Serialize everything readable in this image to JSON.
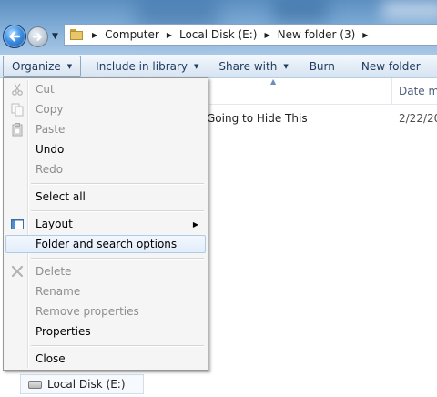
{
  "address_bar": {
    "breadcrumbs": [
      "Computer",
      "Local Disk (E:)",
      "New folder (3)"
    ]
  },
  "command_bar": {
    "organize": "Organize",
    "include_in_library": "Include in library",
    "share_with": "Share with",
    "burn": "Burn",
    "new_folder": "New folder"
  },
  "file_list": {
    "column_date": "Date m",
    "items": [
      {
        "name": "Going to Hide This",
        "date": "2/22/20"
      }
    ]
  },
  "navigation_pane": {
    "drive_label": "Local Disk (E:)"
  },
  "organize_menu": {
    "items": [
      {
        "label": "Cut",
        "enabled": false,
        "icon": "cut-icon"
      },
      {
        "label": "Copy",
        "enabled": false,
        "icon": "copy-icon"
      },
      {
        "label": "Paste",
        "enabled": false,
        "icon": "paste-icon"
      },
      {
        "label": "Undo",
        "enabled": true
      },
      {
        "label": "Redo",
        "enabled": false
      },
      {
        "label": "Select all",
        "enabled": true
      },
      {
        "label": "Layout",
        "enabled": true,
        "icon": "layout-icon",
        "submenu": true
      },
      {
        "label": "Folder and search options",
        "enabled": true,
        "highlighted": true
      },
      {
        "label": "Delete",
        "enabled": false,
        "icon": "delete-icon"
      },
      {
        "label": "Rename",
        "enabled": false
      },
      {
        "label": "Remove properties",
        "enabled": false
      },
      {
        "label": "Properties",
        "enabled": true
      },
      {
        "label": "Close",
        "enabled": true
      }
    ]
  },
  "colors": {
    "menu_highlight": "#e3eefa",
    "command_text": "#1e395b",
    "disabled_text": "#8d8d8d"
  }
}
